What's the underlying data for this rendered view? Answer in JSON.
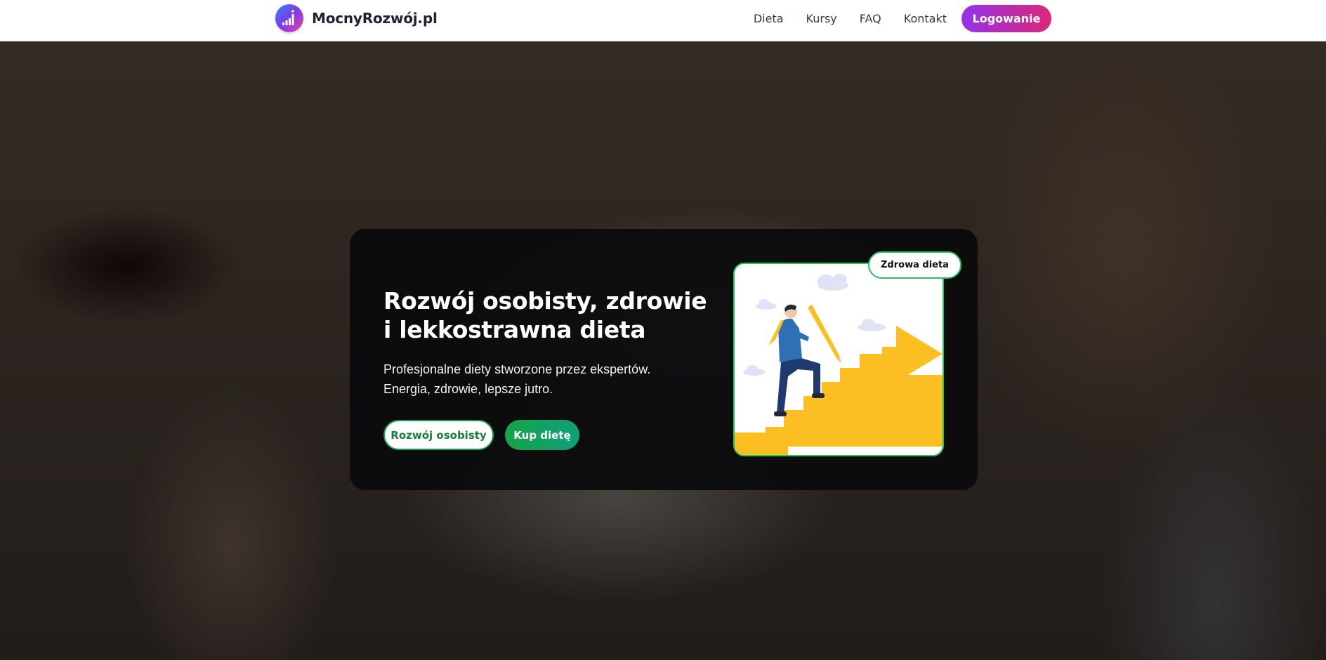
{
  "header": {
    "brand": "MocnyRozwój.pl",
    "nav": [
      "Dieta",
      "Kursy",
      "FAQ",
      "Kontakt"
    ],
    "login_label": "Logowanie"
  },
  "hero": {
    "title": "Rozwój osobisty, zdrowie i lekkostrawna dieta",
    "subtitle_line1": "Profesjonalne diety stworzone przez ekspertów.",
    "subtitle_line2": "Energia, zdrowie, lepsze jutro.",
    "primary_button": "Rozwój osobisty",
    "secondary_button": "Kup dietę",
    "badge": "Zdrowa dieta"
  },
  "colors": {
    "accent_green": "#22c55e",
    "login_gradient_start": "#9333ea",
    "login_gradient_end": "#db2777",
    "stairs_yellow": "#fbbf24"
  },
  "icons": {
    "logo": "growth-chart-icon",
    "illustration": "man-climbing-stairs-with-pencil"
  }
}
